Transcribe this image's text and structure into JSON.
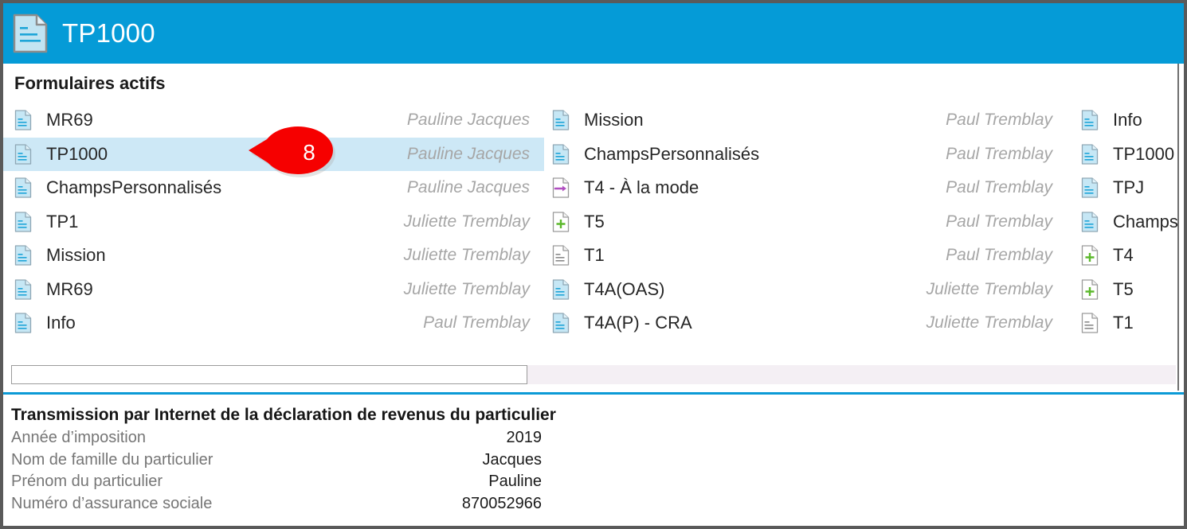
{
  "window": {
    "header": {
      "title": "TP1000",
      "icon": "document-icon",
      "background_color": "#059bd7"
    },
    "section_title": "Formulaires actifs"
  },
  "colors": {
    "header_blue": "#059bd7",
    "selected_row": "#cde8f6",
    "separator_blue": "#0b9ad6",
    "author_grey": "#a6a6a6",
    "callout_red": "#f60000",
    "scrollbar_track": "#f4eff4"
  },
  "forms_list": {
    "columns": [
      {
        "items": [
          {
            "icon": "document-blue-icon",
            "name": "MR69",
            "author": "Pauline Jacques",
            "selected": false
          },
          {
            "icon": "document-blue-icon",
            "name": "TP1000",
            "author": "Pauline Jacques",
            "selected": true
          },
          {
            "icon": "document-blue-icon",
            "name": "ChampsPersonnalisés",
            "author": "Pauline Jacques",
            "selected": false
          },
          {
            "icon": "document-blue-icon",
            "name": "TP1",
            "author": "Juliette Tremblay",
            "selected": false
          },
          {
            "icon": "document-blue-icon",
            "name": "Mission",
            "author": "Juliette Tremblay",
            "selected": false
          },
          {
            "icon": "document-blue-icon",
            "name": "MR69",
            "author": "Juliette Tremblay",
            "selected": false
          },
          {
            "icon": "document-blue-icon",
            "name": "Info",
            "author": "Paul Tremblay",
            "selected": false
          }
        ]
      },
      {
        "items": [
          {
            "icon": "document-blue-icon",
            "name": "Mission",
            "author": "Paul Tremblay",
            "selected": false
          },
          {
            "icon": "document-blue-icon",
            "name": "ChampsPersonnalisés",
            "author": "Paul Tremblay",
            "selected": false
          },
          {
            "icon": "document-arrow-purple-icon",
            "name": "T4 - À la mode",
            "author": "Paul Tremblay",
            "selected": false
          },
          {
            "icon": "document-plus-green-icon",
            "name": "T5",
            "author": "Paul Tremblay",
            "selected": false
          },
          {
            "icon": "document-plain-grey-icon",
            "name": "T1",
            "author": "Paul Tremblay",
            "selected": false
          },
          {
            "icon": "document-blue-icon",
            "name": "T4A(OAS)",
            "author": "Juliette Tremblay",
            "selected": false
          },
          {
            "icon": "document-blue-icon",
            "name": "T4A(P) - CRA",
            "author": "Juliette Tremblay",
            "selected": false
          }
        ]
      },
      {
        "items": [
          {
            "icon": "document-blue-icon",
            "name": "Info",
            "author": "",
            "selected": false
          },
          {
            "icon": "document-blue-icon",
            "name": "TP1000",
            "author": "",
            "selected": false
          },
          {
            "icon": "document-blue-icon",
            "name": "TPJ",
            "author": "",
            "selected": false
          },
          {
            "icon": "document-blue-icon",
            "name": "Champs",
            "author": "",
            "selected": false
          },
          {
            "icon": "document-plus-green-icon",
            "name": "T4",
            "author": "",
            "selected": false
          },
          {
            "icon": "document-plus-green-icon",
            "name": "T5",
            "author": "",
            "selected": false
          },
          {
            "icon": "document-plain-grey-icon",
            "name": "T1",
            "author": "",
            "selected": false
          }
        ]
      }
    ]
  },
  "scrollbar": {
    "orientation": "horizontal",
    "thumb_position_percent": 0
  },
  "detail": {
    "title": "Transmission par Internet de la déclaration de revenus du particulier",
    "rows": [
      {
        "label": "Année d’imposition",
        "value": "2019"
      },
      {
        "label": "Nom de famille du particulier",
        "value": "Jacques"
      },
      {
        "label": "Prénom du particulier",
        "value": "Pauline"
      },
      {
        "label": "Numéro d’assurance sociale",
        "value": "870052966"
      }
    ]
  },
  "callout": {
    "number": "8"
  }
}
